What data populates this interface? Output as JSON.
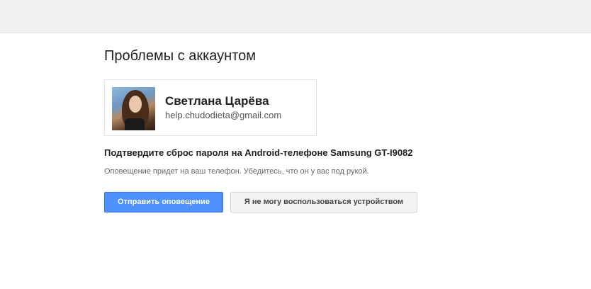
{
  "page": {
    "title": "Проблемы с аккаунтом"
  },
  "account": {
    "name": "Светлана Царёва",
    "email": "help.chudodieta@gmail.com"
  },
  "confirm": {
    "heading": "Подтвердите сброс пароля на Android-телефоне Samsung GT-I9082",
    "notice": "Оповещение придет на ваш телефон. Убедитесь, что он у вас под рукой."
  },
  "actions": {
    "send_label": "Отправить оповещение",
    "cant_use_label": "Я не могу воспользоваться устройством"
  },
  "colors": {
    "primary_button": "#4d90fe",
    "secondary_button": "#f3f3f3",
    "top_bar": "#f1f1f1"
  }
}
